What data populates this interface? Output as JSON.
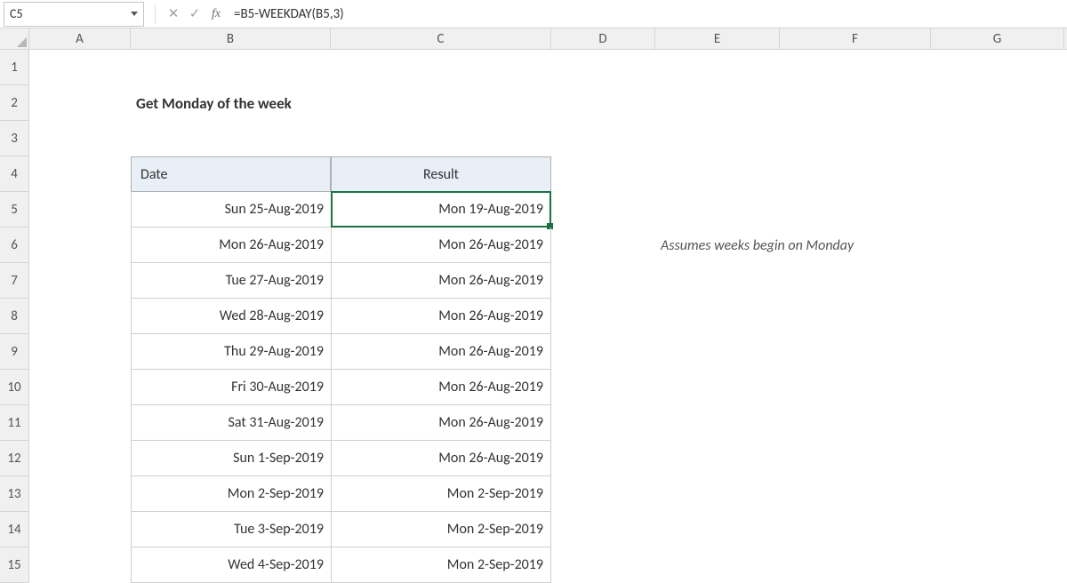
{
  "nameBox": "C5",
  "formula": "=B5-WEEKDAY(B5,3)",
  "colLabels": {
    "A": "A",
    "B": "B",
    "C": "C",
    "D": "D",
    "E": "E",
    "F": "F",
    "G": "G"
  },
  "rowLabels": [
    "1",
    "2",
    "3",
    "4",
    "5",
    "6",
    "7",
    "8",
    "9",
    "10",
    "11",
    "12",
    "13",
    "14",
    "15"
  ],
  "title": "Get Monday of the week",
  "headers": {
    "date": "Date",
    "result": "Result"
  },
  "rows": [
    {
      "date": "Sun 25-Aug-2019",
      "result": "Mon 19-Aug-2019"
    },
    {
      "date": "Mon 26-Aug-2019",
      "result": "Mon 26-Aug-2019"
    },
    {
      "date": "Tue 27-Aug-2019",
      "result": "Mon 26-Aug-2019"
    },
    {
      "date": "Wed 28-Aug-2019",
      "result": "Mon 26-Aug-2019"
    },
    {
      "date": "Thu 29-Aug-2019",
      "result": "Mon 26-Aug-2019"
    },
    {
      "date": "Fri 30-Aug-2019",
      "result": "Mon 26-Aug-2019"
    },
    {
      "date": "Sat 31-Aug-2019",
      "result": "Mon 26-Aug-2019"
    },
    {
      "date": "Sun 1-Sep-2019",
      "result": "Mon 26-Aug-2019"
    },
    {
      "date": "Mon 2-Sep-2019",
      "result": "Mon 2-Sep-2019"
    },
    {
      "date": "Tue 3-Sep-2019",
      "result": "Mon 2-Sep-2019"
    },
    {
      "date": "Wed 4-Sep-2019",
      "result": "Mon 2-Sep-2019"
    }
  ],
  "note": "Assumes weeks begin on Monday"
}
